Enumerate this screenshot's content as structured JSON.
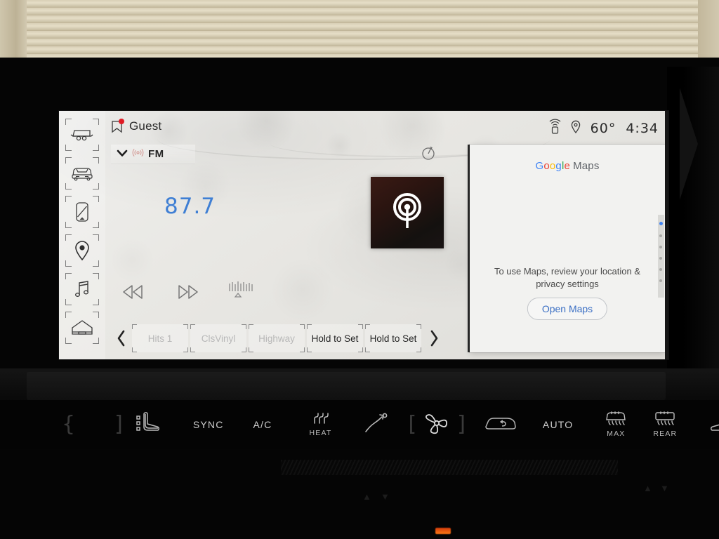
{
  "device": {
    "kind": "vehicle-infotainment-touchscreen",
    "screen_time": "4:34",
    "outside_temp": "60°"
  },
  "statusbar": {
    "wifi_icon": "wifi-hotspot-icon",
    "location_icon": "location-pin-icon",
    "temperature": "60°",
    "clock": "4:34"
  },
  "profile": {
    "name": "Guest",
    "icon": "profile-tag-icon",
    "notification_dot": true,
    "dot_color": "#e01b24"
  },
  "sidebar": {
    "items": [
      {
        "name": "trailer",
        "icon": "trailer-icon",
        "label": "Trailer"
      },
      {
        "name": "vehicle",
        "icon": "vehicle-front-icon",
        "label": "Vehicle"
      },
      {
        "name": "phone",
        "icon": "phone-device-icon",
        "label": "Phone"
      },
      {
        "name": "navigation",
        "icon": "location-pin-icon",
        "label": "Navigation"
      },
      {
        "name": "audio",
        "icon": "music-note-icon",
        "label": "Audio"
      },
      {
        "name": "home",
        "icon": "home-icon",
        "label": "Home"
      }
    ]
  },
  "radio": {
    "source_label": "FM",
    "source_icon": "radio-waves-icon",
    "chevron_icon": "chevron-down-icon",
    "frequency": "87.7",
    "frequency_color": "#3f7fd4",
    "album_art_icon": "broadcast-target-icon",
    "replay_icon": "replay-clock-icon",
    "transport": [
      {
        "name": "rewind",
        "icon": "rewind-icon"
      },
      {
        "name": "forward",
        "icon": "fast-forward-icon"
      },
      {
        "name": "tune",
        "icon": "tuning-slider-icon"
      }
    ],
    "preset_prev_icon": "chevron-left-icon",
    "preset_next_icon": "chevron-right-icon",
    "presets": [
      {
        "label": "Hits 1",
        "state": "dim"
      },
      {
        "label": "ClsVinyl",
        "state": "dim"
      },
      {
        "label": "Highway",
        "state": "dim"
      },
      {
        "label": "Hold to Set",
        "state": "set"
      },
      {
        "label": "Hold to Set",
        "state": "set"
      }
    ]
  },
  "maps_panel": {
    "brand_google": [
      "G",
      "o",
      "o",
      "g",
      "l",
      "e"
    ],
    "brand_maps": "Maps",
    "message": "To use Maps, review your location & privacy settings",
    "button_label": "Open Maps",
    "button_text_color": "#3b6fc4",
    "scrollbar_accent": "#4285F4"
  },
  "climate": {
    "left_controls": [
      {
        "name": "driver-temp-bracket-left",
        "glyph": "{",
        "type": "bracket"
      },
      {
        "name": "driver-temp-bracket-right",
        "glyph": "]",
        "type": "bracket"
      },
      {
        "name": "driver-seat-heat",
        "icon": "seat-heat-icon"
      },
      {
        "name": "sync",
        "label": "SYNC"
      },
      {
        "name": "ac",
        "label": "A/C"
      },
      {
        "name": "heat",
        "label": "HEAT",
        "icon": "heat-waves-icon"
      },
      {
        "name": "airflow",
        "icon": "airflow-icon"
      },
      {
        "name": "fan-bracket-left",
        "glyph": "[",
        "type": "bracket"
      },
      {
        "name": "fan",
        "icon": "fan-icon"
      },
      {
        "name": "fan-bracket-right",
        "glyph": "]",
        "type": "bracket"
      }
    ],
    "right_controls": [
      {
        "name": "recirculate",
        "icon": "recirculate-icon"
      },
      {
        "name": "auto",
        "label": "AUTO"
      },
      {
        "name": "max-defrost",
        "label": "MAX",
        "icon": "front-defrost-icon"
      },
      {
        "name": "rear-defrost",
        "label": "REAR",
        "icon": "rear-defrost-icon"
      },
      {
        "name": "passenger-seat-heat",
        "icon": "seat-heat-icon"
      },
      {
        "name": "passenger-temp-bracket-left",
        "glyph": "[",
        "type": "bracket"
      },
      {
        "name": "passenger-temp-bracket-right",
        "glyph": "}",
        "type": "bracket"
      }
    ]
  }
}
